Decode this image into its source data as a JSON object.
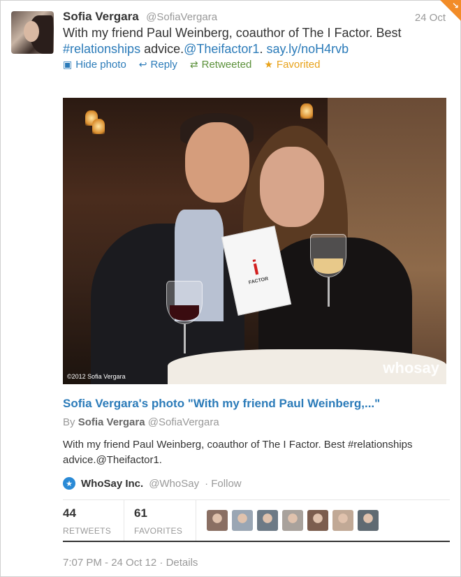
{
  "tweet": {
    "name": "Sofia Vergara",
    "handle": "@SofiaVergara",
    "date": "24 Oct",
    "text_part1": "With my friend Paul Weinberg, coauthor of The I Factor. Best",
    "hashtag": "#relationships",
    "text_part2": " advice.",
    "mention": "@Theifactor1",
    "period": ". ",
    "url": "say.ly/noH4rvb"
  },
  "actions": [
    {
      "label": "Hide photo",
      "icon": "photo-icon"
    },
    {
      "label": "Reply",
      "icon": "reply-icon"
    },
    {
      "label": "Retweeted",
      "icon": "retweet-icon"
    },
    {
      "label": "Favorited",
      "icon": "star-icon"
    }
  ],
  "photo": {
    "copyright": "©2012 Sofia Vergara",
    "watermark": "whosay",
    "book_title": "FACTOR",
    "book_letter": "i"
  },
  "card": {
    "title": "Sofia Vergara's photo \"With my friend Paul Weinberg,...\"",
    "by_label": "By",
    "by_name": "Sofia Vergara",
    "by_handle": "@SofiaVergara",
    "description": "With my friend Paul Weinberg, coauthor of The I Factor. Best #relationships advice.@Theifactor1."
  },
  "source": {
    "name": "WhoSay Inc.",
    "handle": "@WhoSay",
    "follow": "· Follow"
  },
  "stats": {
    "retweets_count": "44",
    "retweets_label": "RETWEETS",
    "favorites_count": "61",
    "favorites_label": "FAVORITES"
  },
  "favoriters": [
    "#8a6f63",
    "#9aa6b4",
    "#6d7a86",
    "#a9a29c",
    "#7c5d4e",
    "#c1a996",
    "#5f6a72"
  ],
  "footer": {
    "time": "7:07 PM - 24 Oct 12",
    "details": "· Details"
  },
  "colors": {
    "link": "#2b7bb9",
    "retweet": "#5c913b",
    "favorite": "#e8a21a",
    "corner": "#f28c28"
  }
}
